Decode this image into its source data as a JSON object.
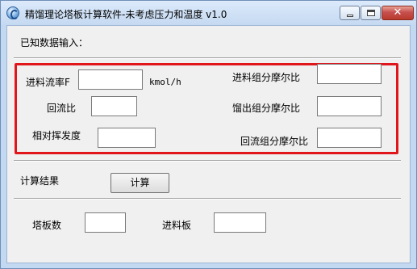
{
  "window": {
    "title": "精馏理论塔板计算软件-未考虑压力和温度 v1.0"
  },
  "titlebar": {
    "close_glyph": "✕"
  },
  "sections": {
    "input_header": "已知数据输入：",
    "result_header": "计算结果"
  },
  "inputs": {
    "feed_flow": {
      "label": "进料流率F",
      "unit": "kmol/h",
      "value": ""
    },
    "reflux_ratio": {
      "label": "回流比",
      "value": ""
    },
    "relative_volatility": {
      "label": "相对挥发度",
      "value": ""
    },
    "feed_mole_fraction": {
      "label": "进料组分摩尔比",
      "value": ""
    },
    "distillate_mole_fraction": {
      "label": "馏出组分摩尔比",
      "value": ""
    },
    "reflux_mole_fraction": {
      "label": "回流组分摩尔比",
      "value": ""
    }
  },
  "buttons": {
    "calculate": "计算"
  },
  "results": {
    "plates": {
      "label": "塔板数",
      "value": ""
    },
    "feed_plate": {
      "label": "进料板",
      "value": ""
    }
  },
  "colors": {
    "highlight_border": "#e0161b"
  }
}
